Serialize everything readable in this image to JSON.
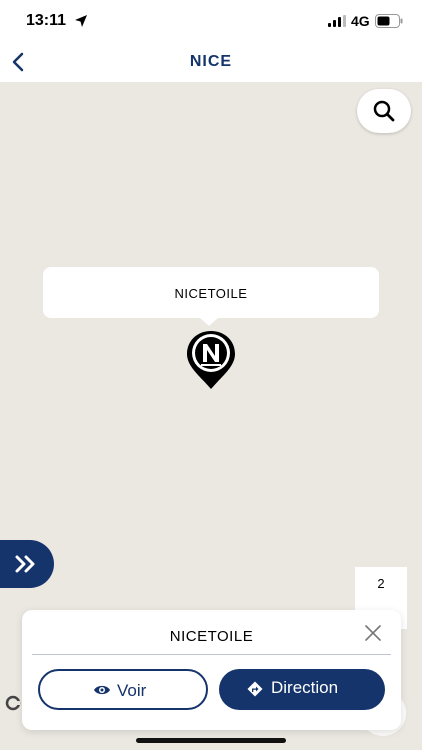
{
  "status_bar": {
    "time": "13:11",
    "network": "4G"
  },
  "header": {
    "title": "NICE"
  },
  "map": {
    "callout_label": "NICETOILE",
    "side_panel_value": "2"
  },
  "card": {
    "title": "NICETOILE",
    "voir_label": "Voir",
    "direction_label": "Direction"
  },
  "colors": {
    "brand": "#14346b",
    "map_bg": "#ebe8e1"
  }
}
